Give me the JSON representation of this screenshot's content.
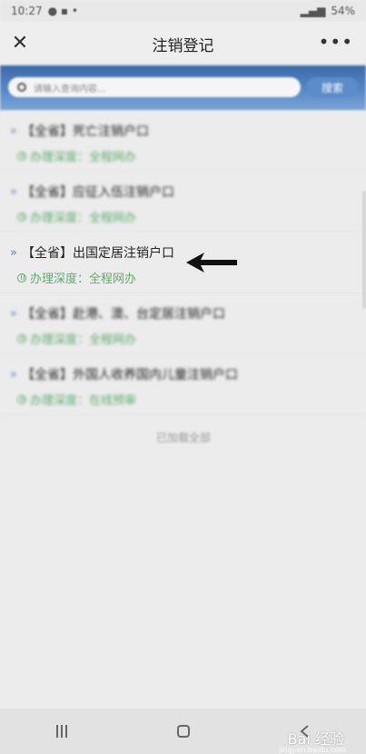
{
  "status_bar": {
    "time": "10:27",
    "battery": "54%"
  },
  "nav": {
    "title": "注销登记",
    "close_icon": "close-icon",
    "more_icon": "more-icon"
  },
  "search": {
    "placeholder": "请输入查询内容...",
    "button_label": "搜索"
  },
  "list": {
    "items": [
      {
        "title": "【全省】死亡注销户口",
        "depth": "办理深度：全程网办"
      },
      {
        "title": "【全省】应征入伍注销户口",
        "depth": "办理深度：全程网办"
      },
      {
        "title": "【全省】出国定居注销户口",
        "depth": "办理深度：全程网办"
      },
      {
        "title": "【全省】赴港、澳、台定居注销户口",
        "depth": "办理深度：全程网办"
      },
      {
        "title": "【全省】外国人收养国内儿童注销户口",
        "depth": "办理深度：在线预审"
      }
    ],
    "load_all": "已加载全部"
  },
  "watermark": {
    "brand": "Bai 经验",
    "url": "jingyan.baidu.com"
  },
  "colors": {
    "accent": "#5b8cc9",
    "depth_green": "#5faa6f",
    "chevron": "#6a7fa6"
  }
}
